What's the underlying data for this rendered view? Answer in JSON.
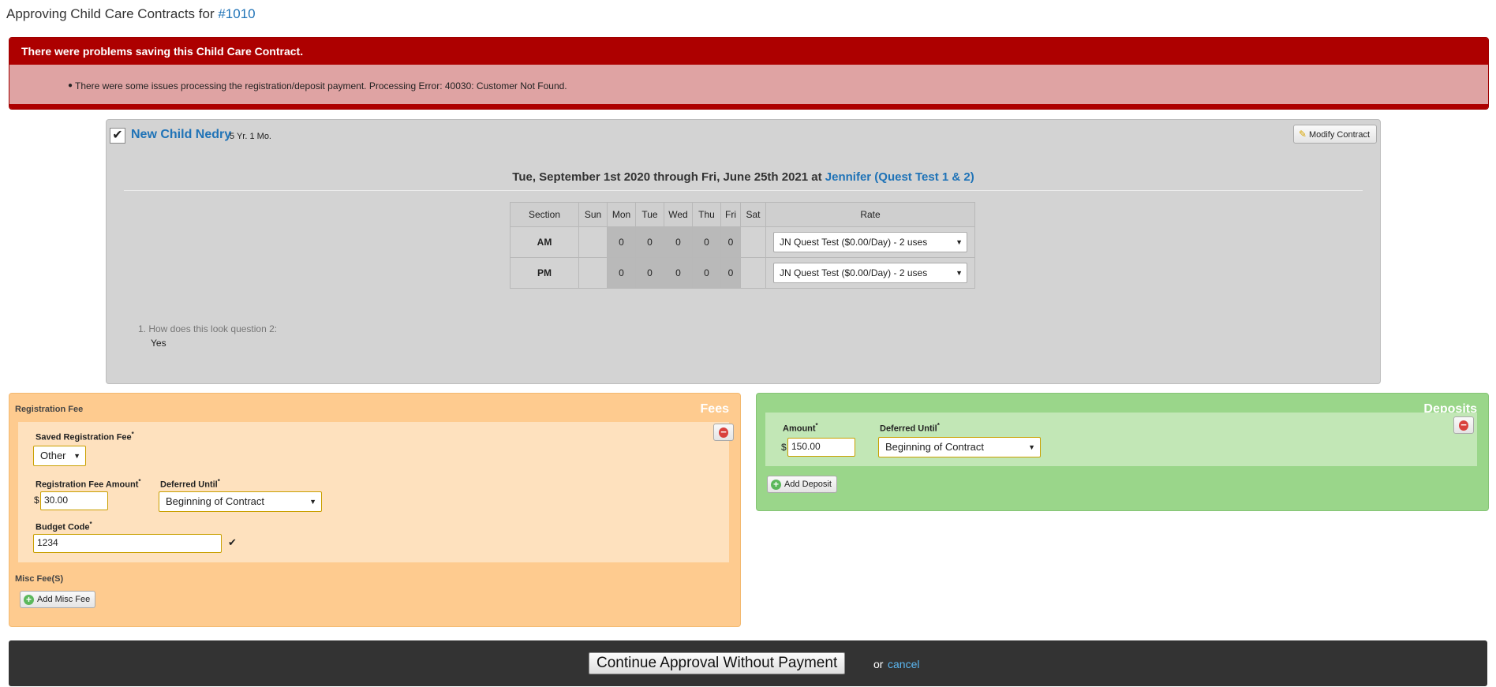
{
  "header": {
    "title_prefix": "Approving Child Care Contracts for ",
    "contract_number": "#1010"
  },
  "error": {
    "title": "There were problems saving this Child Care Contract.",
    "messages": [
      "There were some issues processing the registration/deposit payment. Processing Error: 40030: Customer Not Found."
    ]
  },
  "child": {
    "checked": true,
    "name": "New Child Nedry",
    "age": "5 Yr. 1 Mo.",
    "modify_label": "Modify Contract",
    "dates_text": "Tue, September 1st 2020 through Fri, June 25th 2021 at ",
    "location": "Jennifer (Quest Test 1 & 2)",
    "schedule": {
      "headers": [
        "Section",
        "Sun",
        "Mon",
        "Tue",
        "Wed",
        "Thu",
        "Fri",
        "Sat",
        "Rate"
      ],
      "rows": [
        {
          "section": "AM",
          "days": [
            "",
            "0",
            "0",
            "0",
            "0",
            "0",
            ""
          ],
          "rate": "JN Quest Test ($0.00/Day) - 2 uses"
        },
        {
          "section": "PM",
          "days": [
            "",
            "0",
            "0",
            "0",
            "0",
            "0",
            ""
          ],
          "rate": "JN Quest Test ($0.00/Day) - 2 uses"
        }
      ]
    },
    "question": "1. How does this look question 2:",
    "answer": "Yes"
  },
  "fees": {
    "title": "Fees",
    "registration_label": "Registration Fee",
    "saved_fee_label": "Saved Registration Fee",
    "saved_fee_value": "Other",
    "amount_label": "Registration Fee Amount",
    "currency": "$",
    "amount_value": "30.00",
    "deferred_label": "Deferred Until",
    "deferred_value": "Beginning of Contract",
    "budget_label": "Budget Code",
    "budget_value": "1234",
    "misc_label": "Misc Fee(S)",
    "add_misc_label": "Add Misc Fee",
    "required_mark": "*"
  },
  "deposits": {
    "title": "Deposits",
    "amount_label": "Amount",
    "currency": "$",
    "amount_value": "150.00",
    "deferred_label": "Deferred Until",
    "deferred_value": "Beginning of Contract",
    "add_label": "Add Deposit",
    "required_mark": "*"
  },
  "footer": {
    "continue_label": "Continue Approval Without Payment",
    "or_text": "or",
    "cancel_label": "cancel"
  },
  "colors": {
    "error_red": "#ad0000",
    "fees_orange": "#fecb8f",
    "deposits_green": "#9ad68a",
    "link_blue": "#1f73b7"
  }
}
